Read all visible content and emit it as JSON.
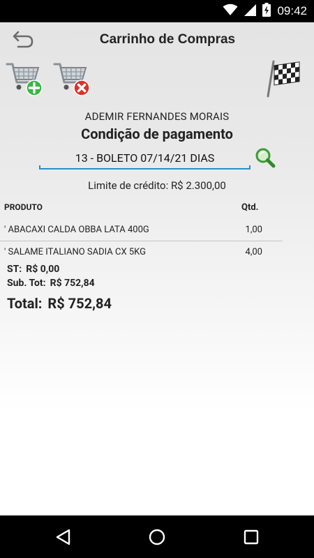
{
  "status_bar": {
    "time": "09:42",
    "icons": [
      "wifi-icon",
      "signal-icon",
      "battery-icon"
    ]
  },
  "action_bar": {
    "title": "Carrinho de Compras",
    "back_icon": "undo-arrow-icon"
  },
  "toolbar": {
    "add_icon": "cart-add-icon",
    "remove_icon": "cart-remove-icon",
    "finish_icon": "checkered-flag-icon"
  },
  "order": {
    "client_name": "ADEMIR FERNANDES MORAIS",
    "payment_heading": "Condição de pagamento",
    "payment_condition": "13 - BOLETO 07/14/21 DIAS",
    "credit_limit": "Limite de crédito: R$ 2.300,00"
  },
  "items_table": {
    "headers": {
      "product": "PRODUTO",
      "qty": "Qtd."
    },
    "rows": [
      {
        "product": "' ABACAXI CALDA OBBA LATA 400G",
        "qty": "1,00"
      },
      {
        "product": "' SALAME ITALIANO SADIA CX 5KG",
        "qty": "4,00"
      }
    ]
  },
  "totals": {
    "st_label": "ST:",
    "st_value": "R$ 0,00",
    "subtotal_label": "Sub. Tot:",
    "subtotal_value": "R$ 752,84",
    "total_label": "Total:",
    "total_value": "R$ 752,84"
  },
  "colors": {
    "accent": "#2a8fbf",
    "cart_add_badge": "#3bb54a",
    "cart_remove_badge": "#d9342b"
  }
}
